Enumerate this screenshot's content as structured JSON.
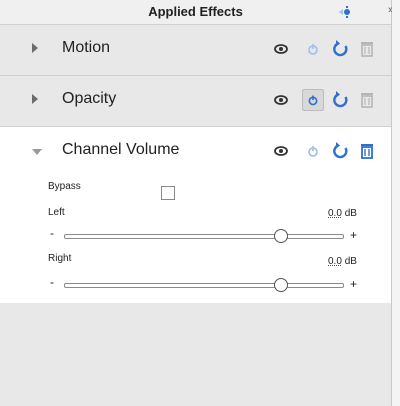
{
  "header": {
    "title": "Applied Effects",
    "overflow_glyph": "»"
  },
  "effects": [
    {
      "name": "Motion"
    },
    {
      "name": "Opacity"
    },
    {
      "name": "Channel Volume"
    }
  ],
  "channel_volume": {
    "bypass_label": "Bypass",
    "bypass_checked": false,
    "left_label": "Left",
    "left_value": "0.0",
    "left_unit": "dB",
    "left_slider_fraction": 0.78,
    "right_label": "Right",
    "right_value": "0.0",
    "right_unit": "dB",
    "right_slider_fraction": 0.78,
    "minus": "-",
    "plus": "+"
  },
  "icons": {
    "visibility": "eye-icon",
    "toggle": "power-icon",
    "reset": "reset-icon",
    "delete": "trash-icon"
  },
  "colors": {
    "accent_blue": "#2f6fcf",
    "light_blue": "#a6c2e8",
    "gray_icon": "#444444"
  }
}
